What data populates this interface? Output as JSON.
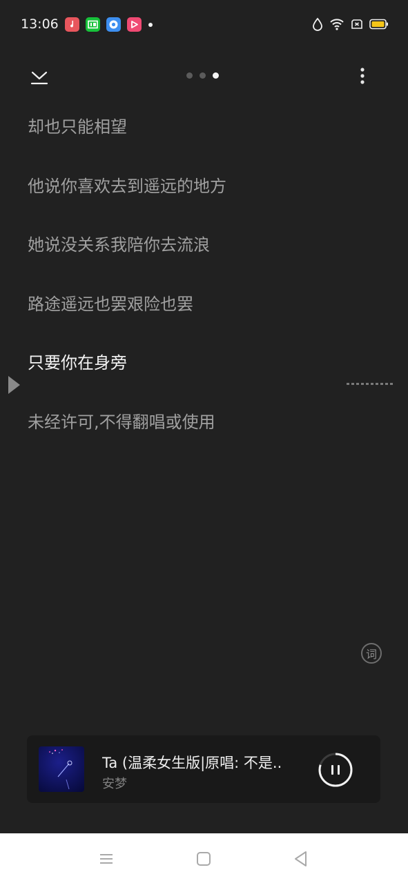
{
  "status_bar": {
    "time": "13:06",
    "notification_icons": [
      "music-app-icon",
      "iqiyi-app-icon",
      "browser-app-icon",
      "video-app-icon"
    ],
    "system_icons": [
      "data-saver-icon",
      "wifi-icon",
      "sim-card-icon",
      "battery-icon"
    ],
    "colors": {
      "music": "#e8565d",
      "iqiyi": "#17c13a",
      "browser": "#3d8ff0",
      "video": "#f04a73",
      "battery": "#f5c518"
    }
  },
  "header": {
    "collapse_icon": "chevron-down-icon",
    "page_count": 3,
    "active_page": 3,
    "more_icon": "more-vertical-icon"
  },
  "lyrics": {
    "lines": [
      "却也只能相望",
      "他说你喜欢去到遥远的地方",
      "她说没关系我陪你去流浪",
      "路途遥远也罢艰险也罢",
      "只要你在身旁",
      "未经许可,不得翻唱或使用"
    ],
    "current_index": 4
  },
  "lyric_toggle": {
    "label": "词"
  },
  "player": {
    "title": "Ta (温柔女生版|原唱: 不是..",
    "artist": "安梦",
    "progress": 0.8,
    "state": "playing"
  },
  "nav_bar": {
    "icons": [
      "menu-icon",
      "home-icon",
      "back-icon"
    ]
  }
}
